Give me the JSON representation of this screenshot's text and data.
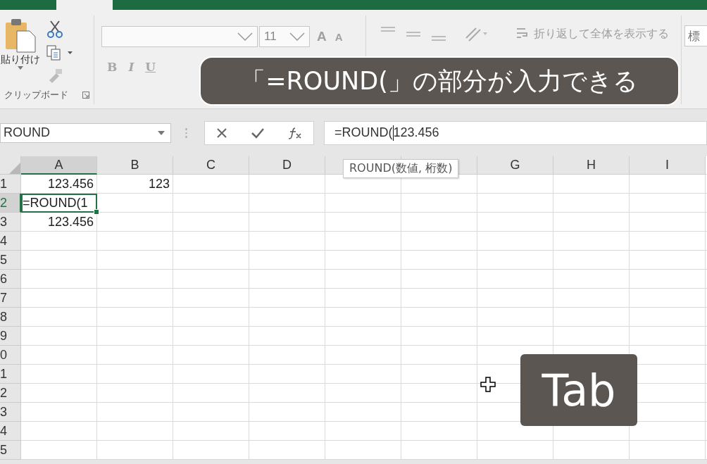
{
  "ribbon": {
    "clipboard": {
      "paste_label": "貼り付け",
      "group_label": "クリップボード"
    },
    "font": {
      "font_size": "11",
      "grow": "A",
      "shrink": "A",
      "bold": "B",
      "italic": "I",
      "underline": "U"
    },
    "alignment": {
      "wrap_text": "折り返して全体を表示する"
    },
    "number": {
      "format": "標"
    }
  },
  "formula_bar": {
    "name_box": "ROUND",
    "before_cursor": "=ROUND(",
    "after_cursor": "123.456"
  },
  "columns": [
    {
      "label": "A",
      "selected": true
    },
    {
      "label": "B",
      "selected": false
    },
    {
      "label": "C",
      "selected": false
    },
    {
      "label": "D",
      "selected": false
    },
    {
      "selected": false
    },
    {
      "selected": false
    },
    {
      "label": "G",
      "selected": false
    },
    {
      "label": "H",
      "selected": false
    },
    {
      "label": "I",
      "selected": false
    }
  ],
  "rows": [
    {
      "label": "1",
      "selected": false,
      "cells": [
        {
          "text": "123.456",
          "selected": false
        },
        {
          "text": "123",
          "selected": false
        }
      ]
    },
    {
      "label": "2",
      "selected": true,
      "cells": [
        {
          "text": "=ROUND(1",
          "selected": true
        }
      ]
    },
    {
      "label": "3",
      "selected": false,
      "cells": [
        {
          "text": "123.456",
          "selected": false
        }
      ]
    },
    {
      "label": "4",
      "selected": false,
      "cells": []
    },
    {
      "label": "5",
      "selected": false,
      "cells": []
    },
    {
      "label": "6",
      "selected": false,
      "cells": []
    },
    {
      "label": "7",
      "selected": false,
      "cells": []
    },
    {
      "label": "8",
      "selected": false,
      "cells": []
    },
    {
      "label": "9",
      "selected": false,
      "cells": []
    },
    {
      "label": "0",
      "selected": false,
      "cells": []
    },
    {
      "label": "1",
      "selected": false,
      "cells": []
    },
    {
      "label": "2",
      "selected": false,
      "cells": []
    },
    {
      "label": "3",
      "selected": false,
      "cells": []
    },
    {
      "label": "4",
      "selected": false,
      "cells": []
    },
    {
      "label": "5",
      "selected": false,
      "cells": []
    }
  ],
  "tooltip": "ROUND(数値, 桁数)",
  "caption": "「=ROUND(」の部分が入力できる",
  "key_hint": "Tab"
}
